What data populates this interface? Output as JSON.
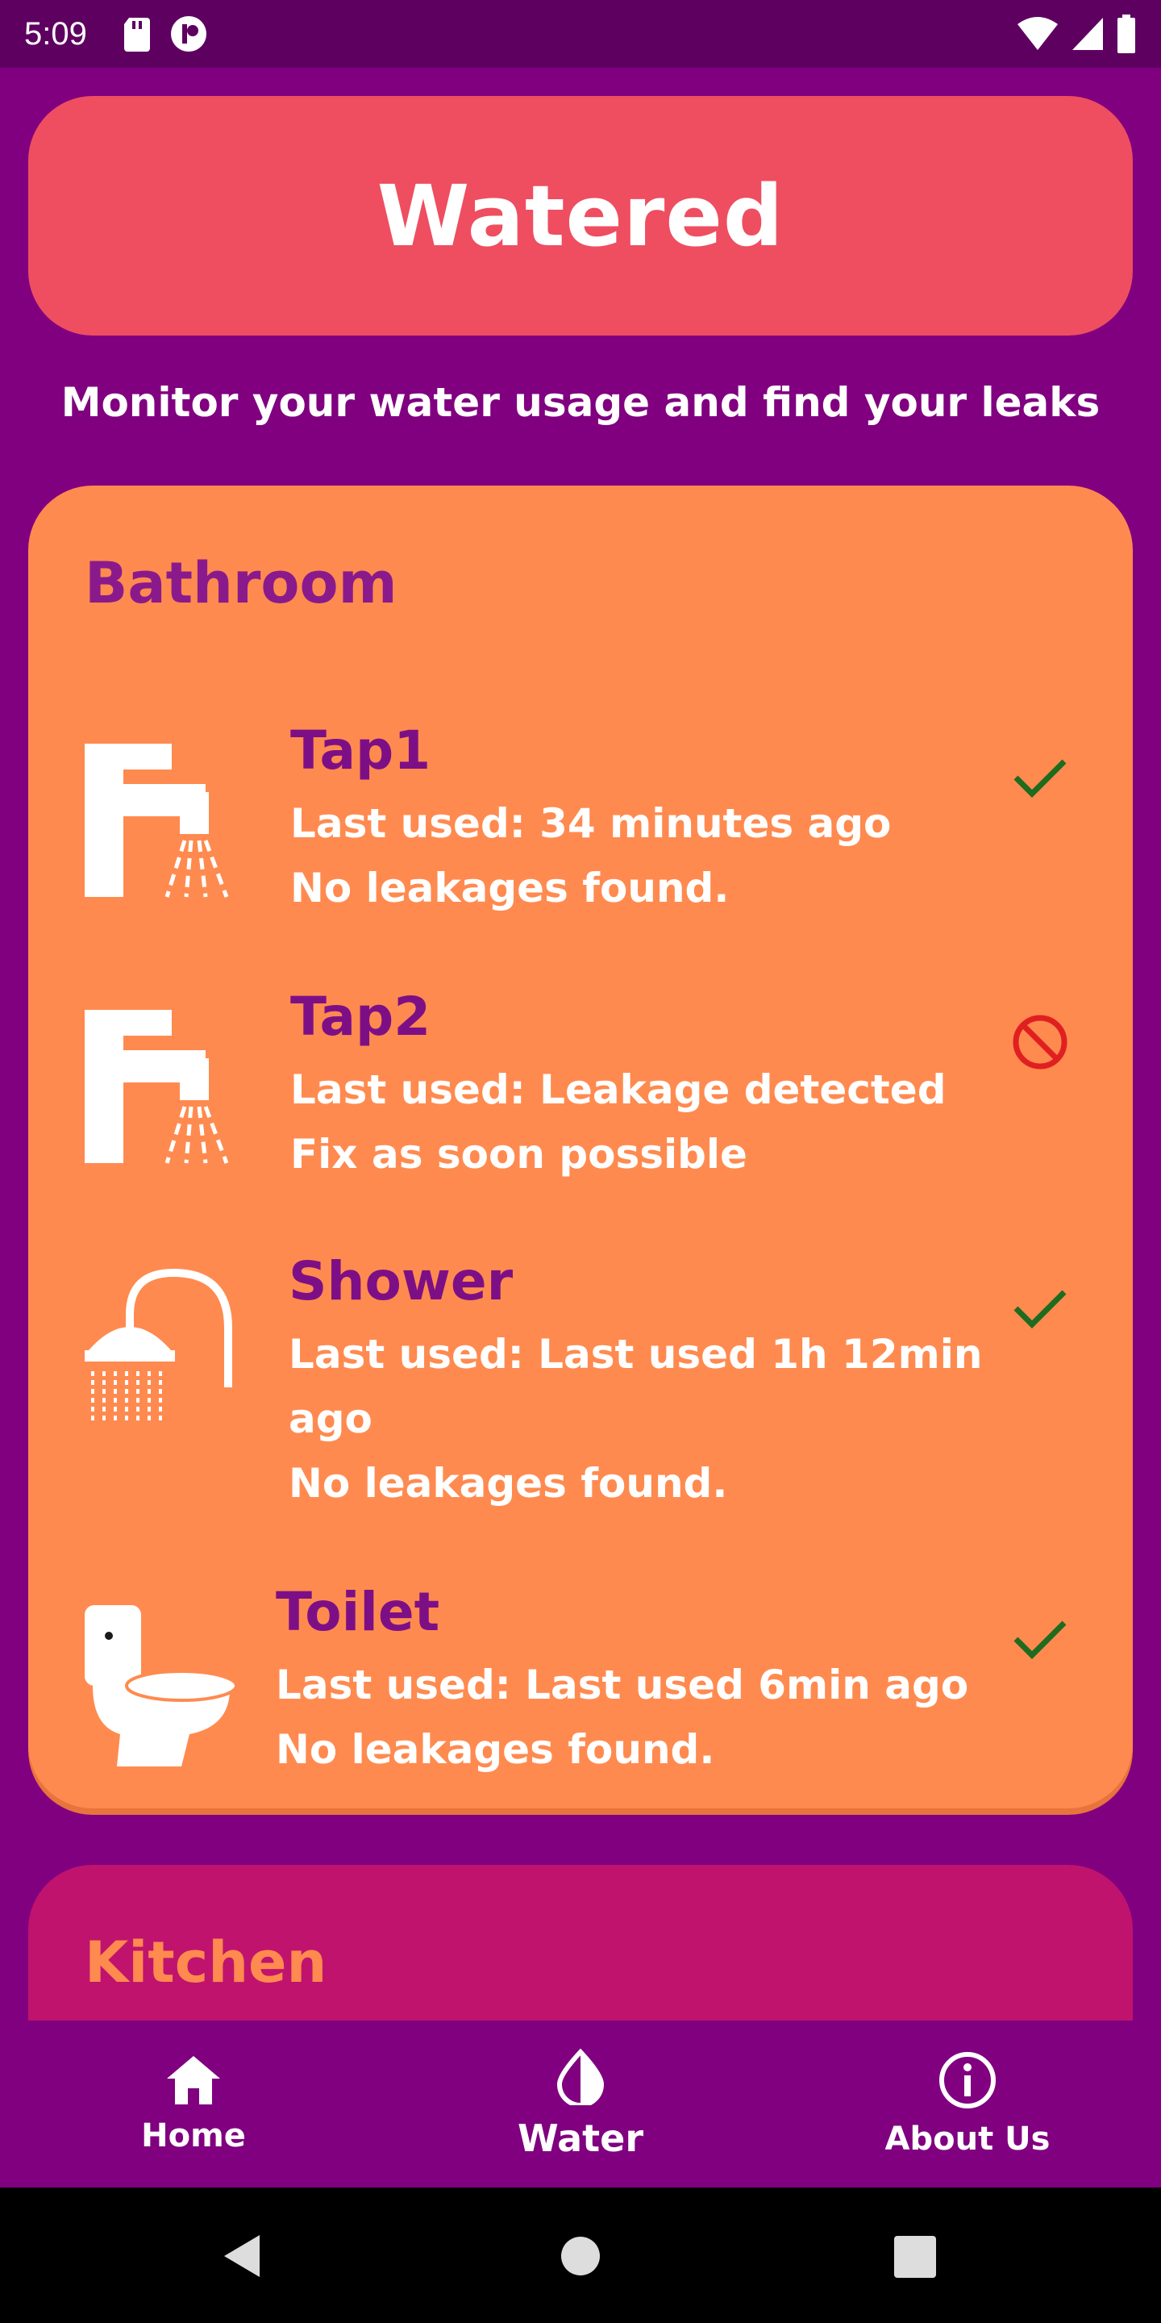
{
  "status_bar": {
    "time": "5:09"
  },
  "header": {
    "title": "Watered"
  },
  "subtitle": "Monitor your water usage and find your leaks",
  "bathroom": {
    "title": "Bathroom",
    "fixtures": [
      {
        "name": "Tap1",
        "line1": "Last used: 34 minutes ago",
        "line2": " No leakages found.",
        "status": "ok"
      },
      {
        "name": "Tap2",
        "line1": "Last used: Leakage detected",
        "line2": " Fix as soon possible",
        "status": "leak"
      },
      {
        "name": "Shower",
        "line1": "Last used: Last used 1h 12min",
        "line1b": "ago",
        "line2": " No leakages found.",
        "status": "ok"
      },
      {
        "name": "Toilet",
        "line1": "Last used: Last used 6min ago",
        "line2": " No leakages found.",
        "status": "ok"
      }
    ]
  },
  "kitchen": {
    "title": "Kitchen"
  },
  "nav": {
    "items": [
      {
        "label": "Home",
        "icon": "home-icon"
      },
      {
        "label": "Water",
        "icon": "water-drop-icon"
      },
      {
        "label": "About Us",
        "icon": "info-icon"
      }
    ],
    "active": "Water"
  },
  "colors": {
    "background": "#800080",
    "header": "#ee4e60",
    "bathroom_card": "#ff8a4f",
    "kitchen_card": "#c0136d",
    "fixture_name": "#7d0f86",
    "ok": "#1f6b1f",
    "leak": "#e02020"
  }
}
